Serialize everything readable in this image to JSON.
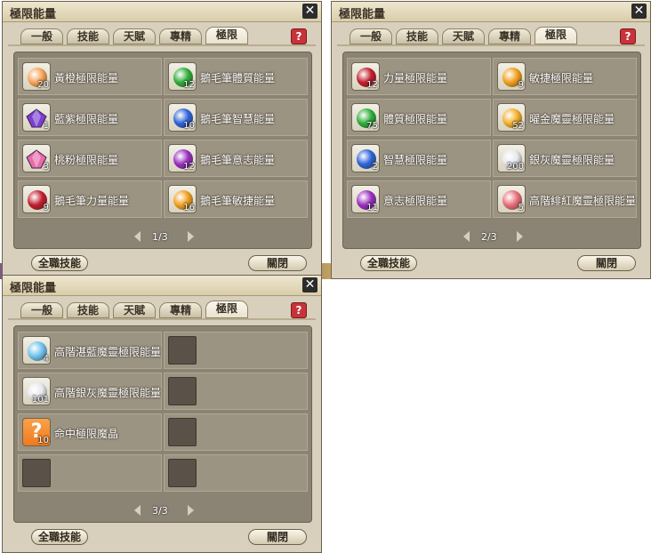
{
  "windows": [
    {
      "title": "極限能量",
      "tabs": [
        "一般",
        "技能",
        "天賦",
        "專精",
        "極限"
      ],
      "active_tab": "極限",
      "items": [
        {
          "label": "黃橙極限能量",
          "qty": "20",
          "icon": "orange-orb-icon",
          "color": "#f6a55a",
          "shape": "orb"
        },
        {
          "label": "鵝毛筆體質能量",
          "qty": "12",
          "icon": "green-orb-icon",
          "color": "#2fae3a",
          "shape": "orb"
        },
        {
          "label": "藍紫極限能量",
          "qty": "1",
          "icon": "purple-crystal-icon",
          "color": "#7a3fd0",
          "shape": "gem"
        },
        {
          "label": "鵝毛筆智慧能量",
          "qty": "10",
          "icon": "blue-orb-icon",
          "color": "#2f64d8",
          "shape": "orb"
        },
        {
          "label": "桃粉極限能量",
          "qty": "3",
          "icon": "pink-crystal-icon",
          "color": "#e86aa8",
          "shape": "gem"
        },
        {
          "label": "鵝毛筆意志能量",
          "qty": "12",
          "icon": "purple-orb-icon",
          "color": "#9a2fbf",
          "shape": "orb"
        },
        {
          "label": "鵝毛筆力量能量",
          "qty": "9",
          "icon": "red-orb-icon",
          "color": "#c21e2e",
          "shape": "orb"
        },
        {
          "label": "鵝毛筆敏捷能量",
          "qty": "16",
          "icon": "gold-orb-icon",
          "color": "#f0a01e",
          "shape": "orb"
        }
      ],
      "page": "1/3",
      "btn_skills": "全職技能",
      "btn_close": "關閉"
    },
    {
      "title": "極限能量",
      "tabs": [
        "一般",
        "技能",
        "天賦",
        "專精",
        "極限"
      ],
      "active_tab": "極限",
      "items": [
        {
          "label": "力量極限能量",
          "qty": "12",
          "icon": "red-orb-icon",
          "color": "#c21e2e",
          "shape": "orb"
        },
        {
          "label": "敏捷極限能量",
          "qty": "9",
          "icon": "gold-orb-icon",
          "color": "#f0a01e",
          "shape": "orb"
        },
        {
          "label": "體質極限能量",
          "qty": "75",
          "icon": "green-orb-icon",
          "color": "#2fae3a",
          "shape": "orb"
        },
        {
          "label": "曜金魔靈極限能量",
          "qty": "52",
          "icon": "gold-orb-icon",
          "color": "#f4b12a",
          "shape": "orb"
        },
        {
          "label": "智慧極限能量",
          "qty": "2",
          "icon": "blue-orb-icon",
          "color": "#2f64d8",
          "shape": "orb"
        },
        {
          "label": "銀灰魔靈極限能量",
          "qty": "200",
          "icon": "silver-orb-icon",
          "color": "#e8e8ec",
          "shape": "orb"
        },
        {
          "label": "意志極限能量",
          "qty": "11",
          "icon": "purple-orb-icon",
          "color": "#9a2fbf",
          "shape": "orb"
        },
        {
          "label": "高階緋紅魔靈極限能量",
          "qty": "5",
          "icon": "crimson-orb-icon",
          "color": "#e8707a",
          "shape": "orb"
        }
      ],
      "page": "2/3",
      "btn_skills": "全職技能",
      "btn_close": "關閉"
    },
    {
      "title": "極限能量",
      "tabs": [
        "一般",
        "技能",
        "天賦",
        "專精",
        "極限"
      ],
      "active_tab": "極限",
      "items": [
        {
          "label": "高階湛藍魔靈極限能量",
          "qty": "4",
          "icon": "light-blue-orb-icon",
          "color": "#6fc3ee",
          "shape": "orb"
        },
        {
          "label": "",
          "qty": "",
          "icon": "",
          "color": "",
          "shape": "empty"
        },
        {
          "label": "高階銀灰魔靈極限能量",
          "qty": "101",
          "icon": "silver-orb-icon",
          "color": "#e8e8ec",
          "shape": "orb"
        },
        {
          "label": "",
          "qty": "",
          "icon": "",
          "color": "",
          "shape": "empty"
        },
        {
          "label": "命中極限魔晶",
          "qty": "10",
          "icon": "question-mark-icon",
          "color": "#f07a1e",
          "shape": "question"
        },
        {
          "label": "",
          "qty": "",
          "icon": "",
          "color": "",
          "shape": "empty"
        },
        {
          "label": "",
          "qty": "",
          "icon": "",
          "color": "",
          "shape": "empty"
        },
        {
          "label": "",
          "qty": "",
          "icon": "",
          "color": "",
          "shape": "empty"
        }
      ],
      "page": "3/3",
      "btn_skills": "全職技能",
      "btn_close": "關閉"
    }
  ],
  "close_glyph": "✕",
  "help_glyph": "?"
}
